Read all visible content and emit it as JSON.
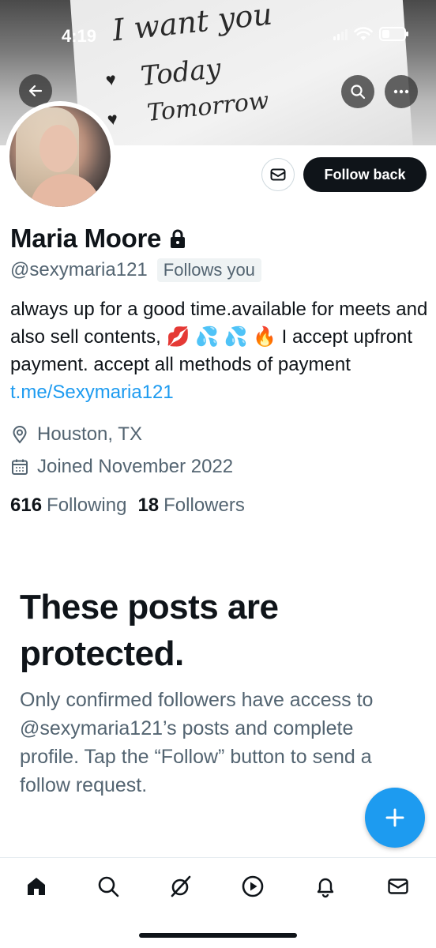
{
  "status_bar": {
    "time": "4:19",
    "icons": [
      "signal-icon",
      "wifi-icon",
      "battery-icon"
    ]
  },
  "banner": {
    "handwriting": [
      "I want you",
      "Today",
      "Tomorrow"
    ]
  },
  "profile": {
    "display_name": "Maria Moore",
    "handle": "@sexymaria121",
    "follows_you_badge": "Follows you",
    "bio_text": "always up for a good time.available for meets and also sell contents, 💋 💦 💦 🔥 I accept upfront payment. accept all methods of payment ",
    "bio_link": "t.me/Sexymaria121",
    "location": "Houston, TX",
    "joined": "Joined November 2022",
    "following_count": "616",
    "following_label": "Following",
    "followers_count": "18",
    "followers_label": "Followers"
  },
  "actions": {
    "follow_back_label": "Follow back"
  },
  "protected": {
    "title": "These posts are protected.",
    "description": "Only confirmed followers have access to @sexymaria121’s posts and complete profile. Tap the “Follow” button to send a follow request."
  },
  "bottom_nav": {
    "items": [
      "home-icon",
      "search-icon",
      "grok-icon",
      "video-icon",
      "notifications-icon",
      "messages-icon"
    ]
  },
  "colors": {
    "accent": "#1d9bf0",
    "text_primary": "#0f1419",
    "text_secondary": "#536471",
    "follow_button": "#0f1419"
  }
}
